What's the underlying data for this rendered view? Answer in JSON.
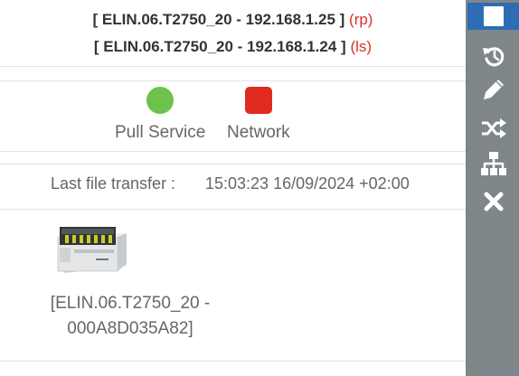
{
  "header": {
    "rp_line": {
      "name": "[ ELIN.06.T2750_20 - 192.168.1.25 ]",
      "role": "(rp)"
    },
    "ls_line": {
      "name": "[ ELIN.06.T2750_20 - 192.168.1.24 ]",
      "role": "(ls)"
    }
  },
  "status": {
    "pull_service": {
      "label": "Pull Service",
      "color": "#6cc24a"
    },
    "network": {
      "label": "Network",
      "color": "#e02b20"
    }
  },
  "transfer": {
    "label": "Last file transfer :",
    "value": "15:03:23 16/09/2024 +02:00"
  },
  "device": {
    "name_line1": "[ELIN.06.T2750_20 -",
    "name_line2": "000A8D035A82]"
  },
  "toolbar": {
    "buttons": [
      {
        "icon": "square-icon",
        "active": true
      },
      {
        "icon": "history-icon"
      },
      {
        "icon": "pencil-icon"
      },
      {
        "icon": "shuffle-icon"
      },
      {
        "icon": "sitemap-icon"
      },
      {
        "icon": "close-icon"
      }
    ],
    "accent": "#2e6db4",
    "background": "#7f868a"
  }
}
